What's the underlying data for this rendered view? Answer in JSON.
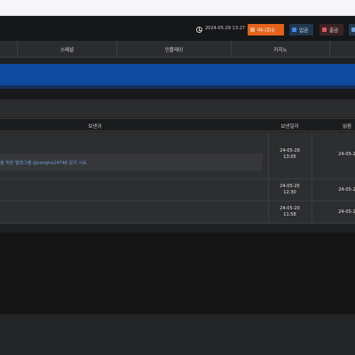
{
  "topbar": {
    "clock_icon": "clock-icon",
    "datetime": "2024-05-29 13:27",
    "money_button": "머니회수",
    "deposit_button": "입금",
    "withdraw_button": "출금"
  },
  "nav": {
    "items": [
      "스페셜",
      "인플레이",
      "카지노"
    ]
  },
  "table": {
    "headers": [
      "보낸이",
      "보낸일자",
      "읽음"
    ],
    "rows": [
      {
        "sent_date": "24-05-29",
        "sent_time": "13:05",
        "read_date": "24-05-2",
        "notice": "을 위한 텔레그램 @songha24748 문의 시도"
      },
      {
        "sent_date": "24-05-25",
        "sent_time": "12:30",
        "read_date": "24-05-2"
      },
      {
        "sent_date": "24-05-20",
        "sent_time": "11:58",
        "read_date": "24-05-2"
      }
    ]
  },
  "colors": {
    "accent_orange": "#e5621a",
    "banner_blue": "#0e4a9e",
    "link_blue": "#6f9ed8"
  }
}
